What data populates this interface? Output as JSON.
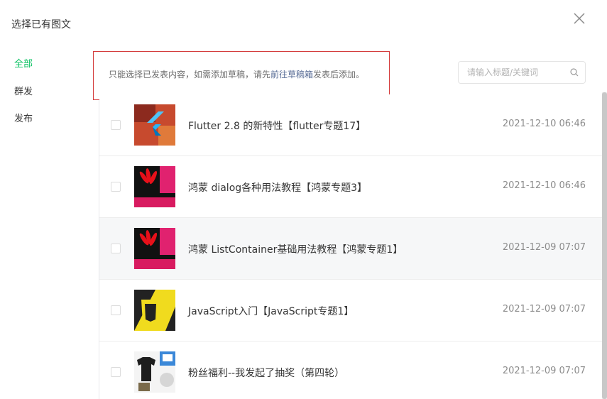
{
  "dialog": {
    "title": "选择已有图文"
  },
  "sidebar": {
    "items": [
      {
        "label": "全部",
        "active": true
      },
      {
        "label": "群发",
        "active": false
      },
      {
        "label": "发布",
        "active": false
      }
    ]
  },
  "notice": {
    "text_before": "只能选择已发表内容，如需添加草稿，请先",
    "link": "前往草稿箱",
    "text_after": "发表后添加。"
  },
  "search": {
    "placeholder": "请输入标题/关键词"
  },
  "articles": [
    {
      "title": "Flutter 2.8 的新特性【flutter专题17】",
      "date": "2021-12-10 06:46",
      "thumb": "flutter"
    },
    {
      "title": "鸿蒙 dialog各种用法教程【鸿蒙专题3】",
      "date": "2021-12-10 06:46",
      "thumb": "harmony"
    },
    {
      "title": "鸿蒙   ListContainer基础用法教程【鸿蒙专题1】",
      "date": "2021-12-09 07:07",
      "thumb": "harmony"
    },
    {
      "title": "JavaScript入门【JavaScript专题1】",
      "date": "2021-12-09 07:07",
      "thumb": "javascript"
    },
    {
      "title": "粉丝福利--我发起了抽奖（第四轮）",
      "date": "2021-12-09 07:07",
      "thumb": "prize"
    }
  ],
  "colors": {
    "accent": "#07c160",
    "link": "#576b95",
    "highlight_border": "#d43c3c"
  }
}
